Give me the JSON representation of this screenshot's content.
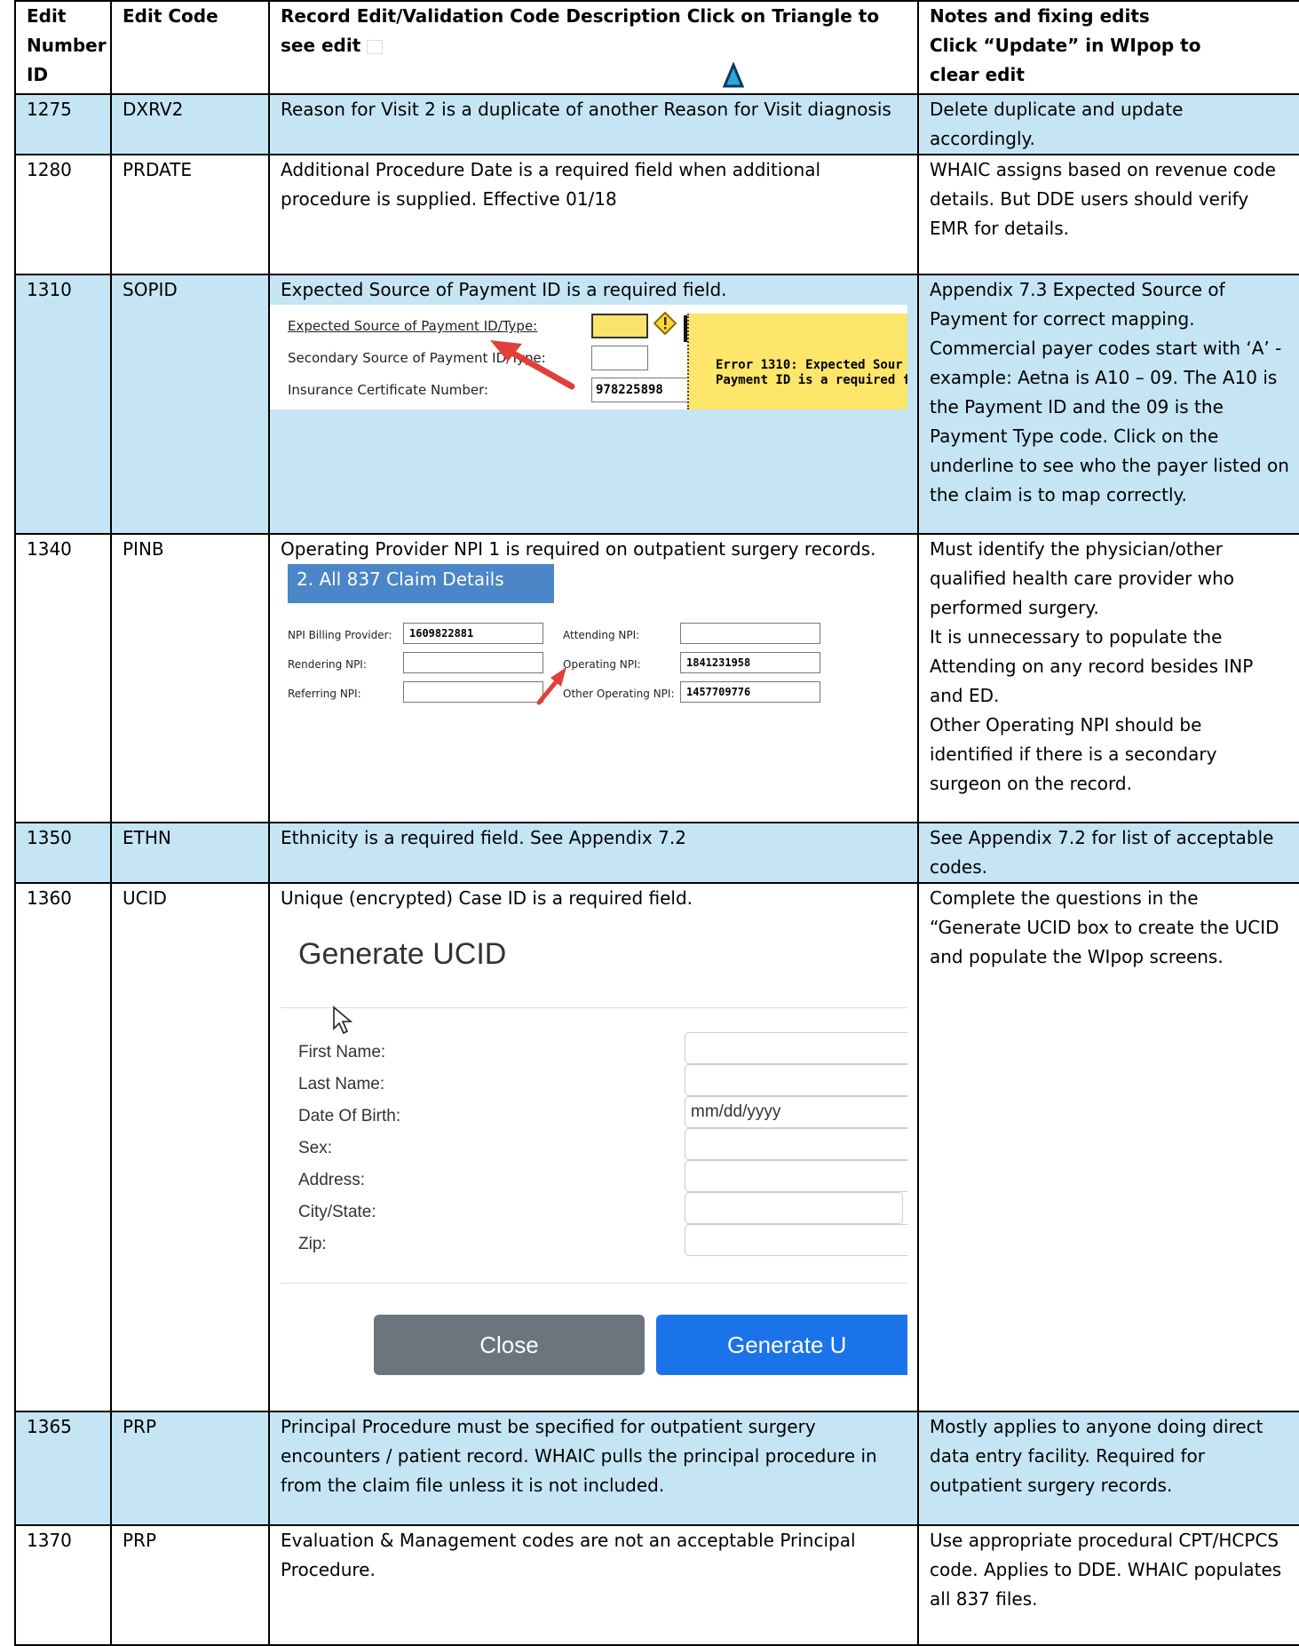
{
  "table": {
    "headers": {
      "edit_number": [
        "Edit",
        "Number",
        "ID"
      ],
      "edit_code": "Edit Code",
      "description": [
        "Record Edit/Validation Code Description Click on Triangle  to",
        "see edit"
      ],
      "notes": [
        "Notes and fixing edits",
        "Click “Update” in WIpop to",
        "clear edit"
      ]
    },
    "rows": [
      {
        "id": "1275",
        "code": "DXRV2",
        "description": "Reason for Visit 2 is a duplicate of another Reason for Visit diagnosis",
        "notes": "Delete duplicate and update accordingly."
      },
      {
        "id": "1280",
        "code": "PRDATE",
        "description": "Additional Procedure Date is a required field when additional procedure is supplied. Effective 01/18",
        "notes": " WHAIC assigns based on revenue code details. But DDE users should verify EMR for details."
      },
      {
        "id": "1310",
        "code": "SOPID",
        "description": "Expected Source of Payment ID is a required field.",
        "notes": "Appendix 7.3 Expected Source of Payment for correct mapping. Commercial payer codes start with ‘A’  - example: Aetna is A10 – 09. The A10 is the Payment ID and the 09 is the Payment Type code. Click on the underline to see who the payer listed on the claim is to map correctly."
      },
      {
        "id": "1340",
        "code": "PINB",
        "description": "Operating Provider NPI 1 is required on outpatient surgery records.",
        "notes": [
          "Must identify the physician/other qualified health care provider who performed surgery.",
          "It is unnecessary to populate the Attending on any record besides INP and ED.",
          "Other Operating NPI should be identified if there is a secondary surgeon on the record."
        ]
      },
      {
        "id": "1350",
        "code": "ETHN",
        "description": "Ethnicity is a required field. See Appendix 7.2",
        "notes": "See Appendix 7.2 for list of acceptable codes."
      },
      {
        "id": "1360",
        "code": "UCID",
        "description": "Unique (encrypted) Case ID is a required field.",
        "notes": "Complete the questions in the “Generate UCID box to create the UCID and populate the WIpop screens."
      },
      {
        "id": "1365",
        "code": "PRP",
        "description": "Principal Procedure must be specified for outpatient surgery encounters / patient record. WHAIC pulls the principal procedure in from the claim file unless it is not included.",
        "notes": "Mostly applies to anyone doing direct data entry facility. Required for outpatient surgery records."
      },
      {
        "id": "1370",
        "code": "PRP",
        "description": "Evaluation & Management codes are not an acceptable Principal Procedure.",
        "notes": "Use appropriate procedural CPT/HCPCS code. Applies to DDE. WHAIC populates all 837 files."
      }
    ]
  },
  "sopid_shot": {
    "expected_label": "Expected Source of Payment ID/Type:",
    "secondary_label": "Secondary Source of Payment ID/Type:",
    "cert_label": "Insurance Certificate Number:",
    "cert_value": "978225898",
    "tooltip": [
      "Error 1310: Expected Sour",
      "Payment ID is a required f"
    ]
  },
  "pinb_shot": {
    "title": "2. All 837 Claim Details",
    "billing_label": "NPI Billing Provider:",
    "billing_value": "1609822881",
    "rendering_label": "Rendering NPI:",
    "referring_label": "Referring NPI:",
    "attending_label": "Attending NPI:",
    "operating_label": "Operating NPI:",
    "operating_value": "1841231958",
    "other_operating_label": "Other Operating NPI:",
    "other_operating_value": "1457709776"
  },
  "ucid_shot": {
    "title": "Generate UCID",
    "fields": [
      "First Name:",
      "Last Name:",
      "Date Of Birth:",
      "Sex:",
      "Address:",
      "City/State:",
      "Zip:"
    ],
    "dob_placeholder": "mm/dd/yyyy",
    "close_label": "Close",
    "generate_label": "Generate U"
  },
  "colors": {
    "row_blue": "#c5e5f5",
    "tooltip_yellow": "#fde66a",
    "header_bar_blue": "#4a86c8",
    "close_button": "#6c757d",
    "generate_button": "#1a73e8",
    "arrow_red": "#e0403a"
  }
}
